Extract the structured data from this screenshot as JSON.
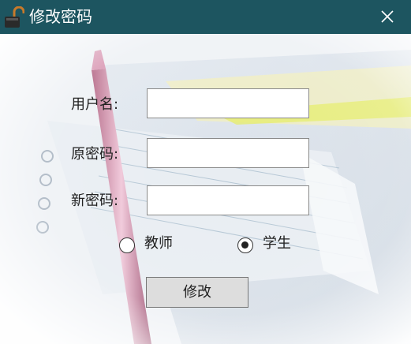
{
  "window": {
    "title": "修改密码",
    "title_bar_color": "#1d5560",
    "close_icon": "close-icon",
    "title_icon": "unlocked-padlock-icon"
  },
  "form": {
    "username_label": "用户名:",
    "username_value": "",
    "old_password_label": "原密码:",
    "old_password_value": "",
    "new_password_label": "新密码:",
    "new_password_value": ""
  },
  "role": {
    "options": [
      {
        "label": "教师",
        "checked": false
      },
      {
        "label": "学生",
        "checked": true
      }
    ]
  },
  "actions": {
    "submit_label": "修改"
  }
}
